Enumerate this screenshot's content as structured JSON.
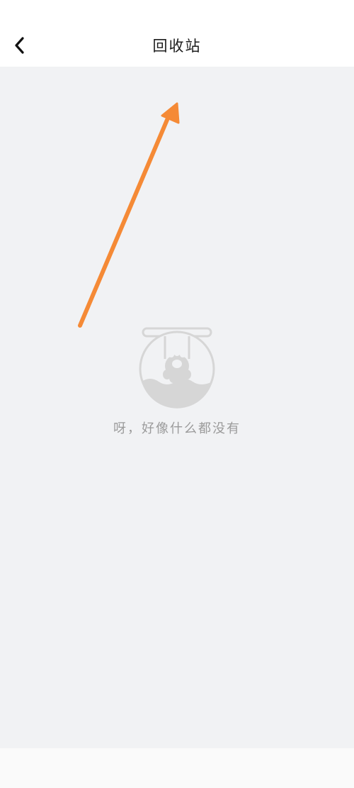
{
  "header": {
    "back_icon": "chevron-left-icon",
    "title": "回收站"
  },
  "empty_state": {
    "illustration_icon": "paw-fishbowl-icon",
    "message": "呀，好像什么都没有"
  },
  "annotation": {
    "arrow_icon": "arrow-up-right-icon",
    "arrow_color": "#f58a36"
  },
  "colors": {
    "background": "#f1f2f4",
    "header": "#ffffff",
    "empty_text": "#9b9b9b"
  }
}
